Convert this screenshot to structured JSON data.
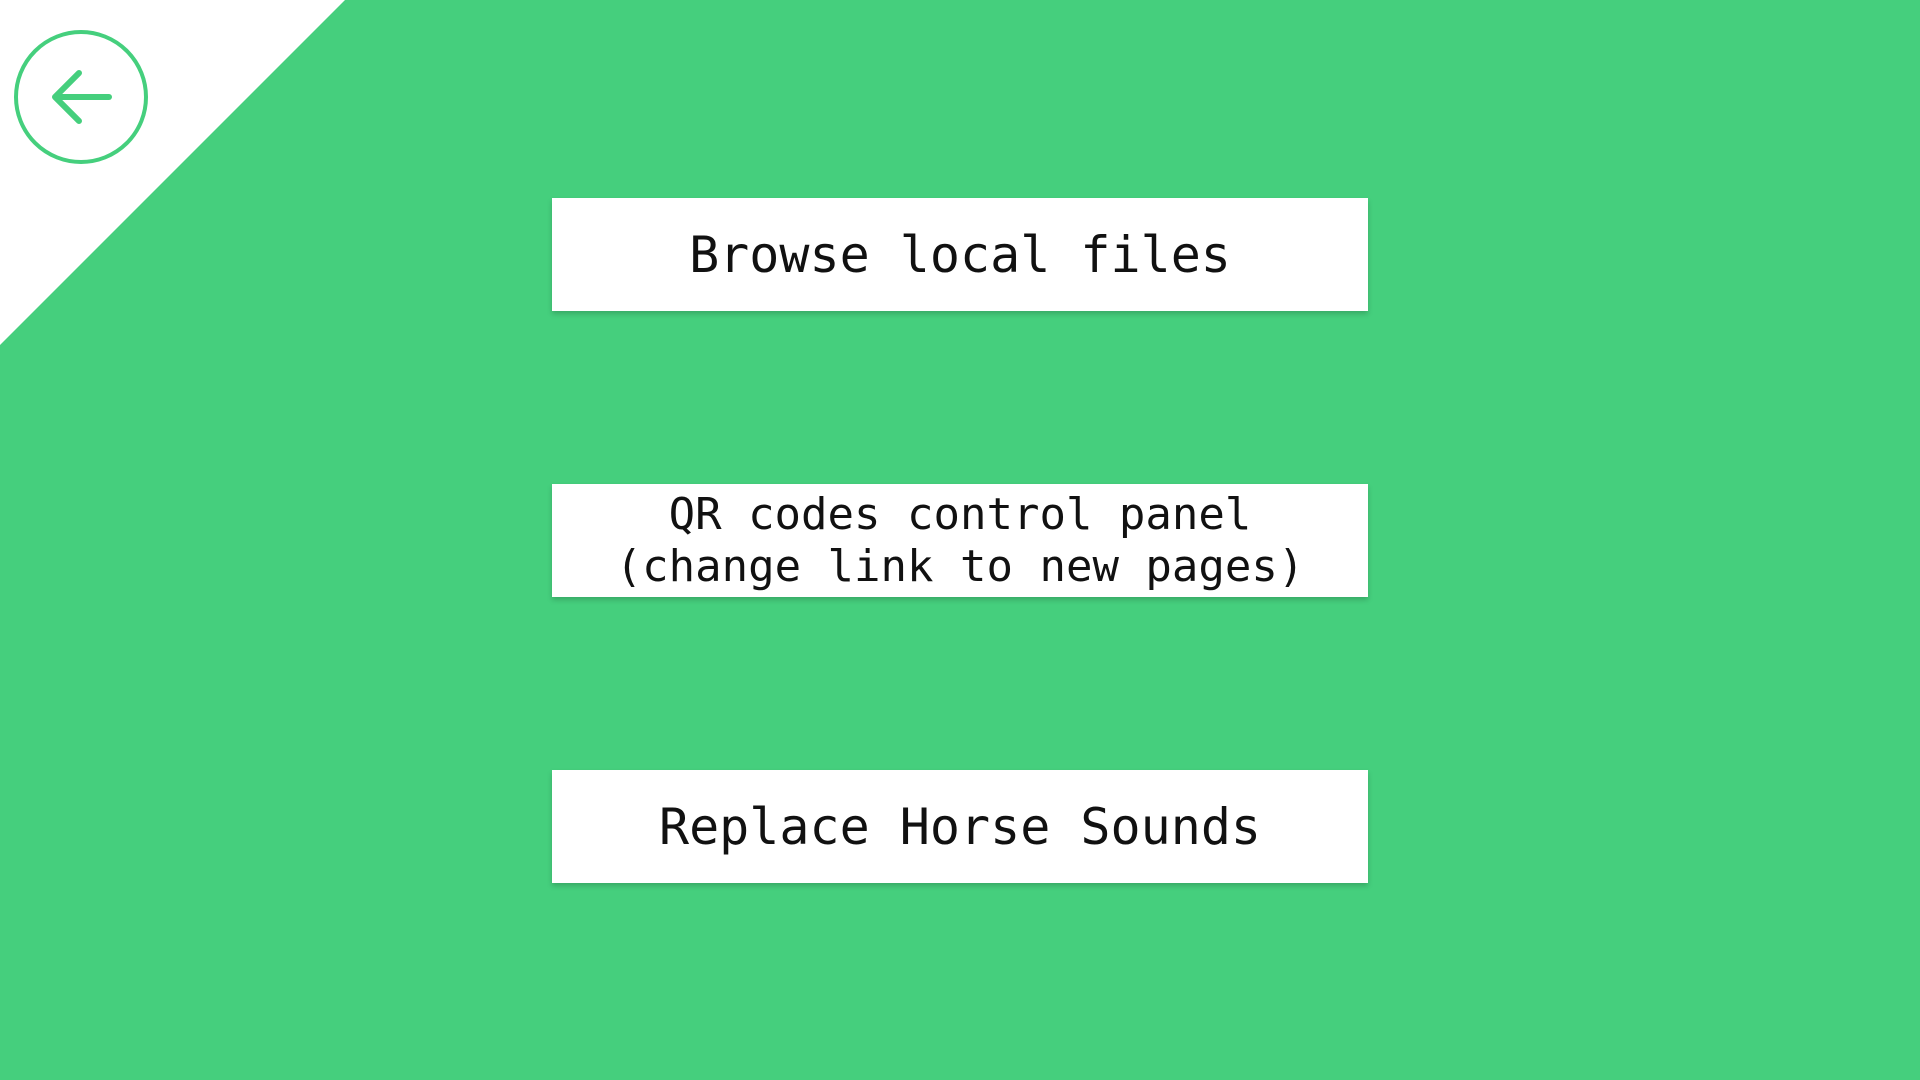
{
  "colors": {
    "background": "#45cf7d",
    "accent": "#45cf7d",
    "button_background": "#ffffff",
    "text": "#111111"
  },
  "back_button": {
    "icon": "arrow-left-icon"
  },
  "menu": {
    "items": [
      {
        "label": "Browse local files"
      },
      {
        "label": "QR codes control panel\n(change link to new pages)"
      },
      {
        "label": "Replace Horse Sounds"
      }
    ]
  }
}
